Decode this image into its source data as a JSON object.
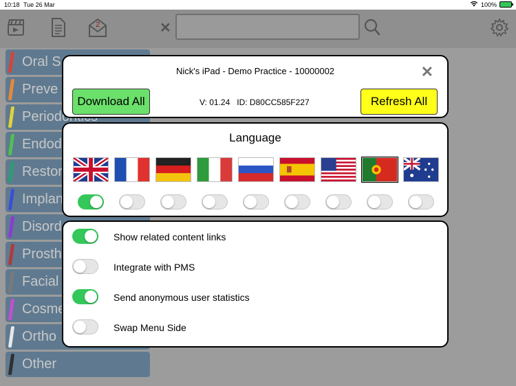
{
  "status_bar": {
    "time": "10:18",
    "date": "Tue 26 Mar",
    "battery": "100%"
  },
  "toolbar": {
    "icons": [
      "clapperboard-icon",
      "document-icon",
      "mail-icon",
      "close-icon",
      "search-icon",
      "gear-icon"
    ],
    "mail_badge": "2"
  },
  "menu": {
    "items": [
      {
        "label": "Oral S",
        "color": "#d2453b"
      },
      {
        "label": "Preve",
        "color": "#e58a3b"
      },
      {
        "label": "Periodontics",
        "color": "#e0d23b"
      },
      {
        "label": "Endod",
        "color": "#4fc24f"
      },
      {
        "label": "Restor",
        "color": "#2e9c74"
      },
      {
        "label": "Implan",
        "color": "#3b4fd2"
      },
      {
        "label": "Disord",
        "color": "#8a3bd2"
      },
      {
        "label": "Prosth",
        "color": "#b03b3b"
      },
      {
        "label": "Facial",
        "color": "#7a7a7a"
      },
      {
        "label": "Cosme",
        "color": "#c24fd2"
      },
      {
        "label": "Ortho",
        "color": "#e8e8e8"
      },
      {
        "label": "Other",
        "color": "#303030"
      }
    ]
  },
  "header_panel": {
    "device_title": "Nick's iPad - Demo Practice - 10000002",
    "download_label": "Download All",
    "refresh_label": "Refresh All",
    "version_text": "V: 01.24   ID: D80CC585F227",
    "download_color": "#6be06b",
    "refresh_color": "#ffff1a"
  },
  "language_panel": {
    "title": "Language",
    "languages": [
      {
        "code": "en-GB",
        "flag": "uk-flag-icon",
        "enabled": true
      },
      {
        "code": "fr",
        "flag": "france-flag-icon",
        "enabled": false
      },
      {
        "code": "de",
        "flag": "germany-flag-icon",
        "enabled": false
      },
      {
        "code": "it",
        "flag": "italy-flag-icon",
        "enabled": false
      },
      {
        "code": "ru",
        "flag": "russia-flag-icon",
        "enabled": false
      },
      {
        "code": "es",
        "flag": "spain-flag-icon",
        "enabled": false
      },
      {
        "code": "en-US",
        "flag": "usa-flag-icon",
        "enabled": false
      },
      {
        "code": "pt",
        "flag": "portugal-flag-icon",
        "enabled": false
      },
      {
        "code": "en-AU",
        "flag": "australia-flag-icon",
        "enabled": false
      }
    ],
    "selected_index": 7
  },
  "settings_panel": {
    "rows": [
      {
        "label": "Show related content links",
        "enabled": true
      },
      {
        "label": "Integrate with PMS",
        "enabled": false
      },
      {
        "label": "Send anonymous user statistics",
        "enabled": true
      },
      {
        "label": "Swap Menu Side",
        "enabled": false
      }
    ]
  },
  "colors": {
    "toggle_on": "#34c759",
    "toggle_off": "#e6e6e6",
    "accent_ios": "#34c759"
  }
}
